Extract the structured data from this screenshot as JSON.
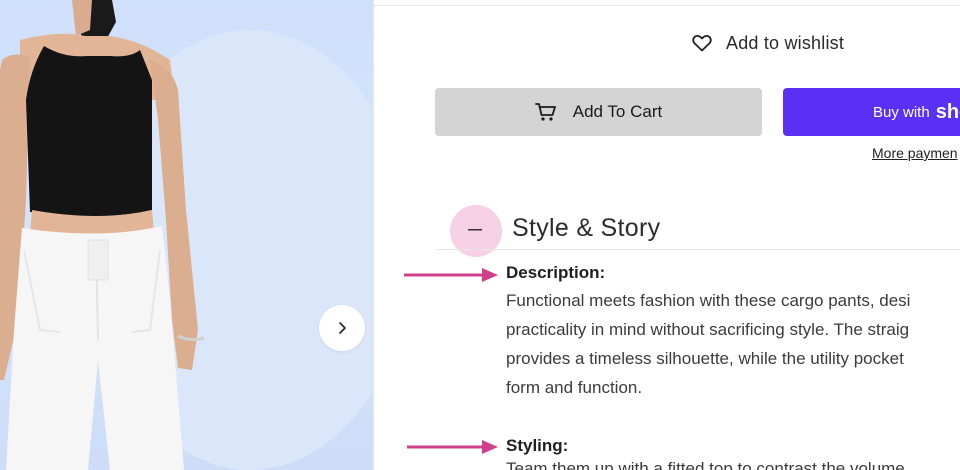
{
  "product_image": {
    "alt_icon": "model-photo"
  },
  "gallery": {
    "next_icon": "chevron-right-icon"
  },
  "wishlist": {
    "label": "Add to wishlist",
    "icon": "heart-icon"
  },
  "cart": {
    "label": "Add To Cart",
    "icon": "cart-icon"
  },
  "buy": {
    "label": "Buy with",
    "brand": "sho"
  },
  "more_payment": {
    "label": "More paymen"
  },
  "accordion": {
    "title": "Style & Story",
    "toggle_icon": "minus-icon",
    "description_heading": "Description:",
    "description_lines": [
      "Functional meets fashion with these cargo pants, desi",
      "practicality in mind without sacrificing style. The straig",
      "provides a timeless silhouette, while the utility pocket",
      "form and function."
    ],
    "styling_heading": "Styling:",
    "styling_line": "Team them up with a fitted top to contrast the volume"
  },
  "colors": {
    "accent": "#5a31f4",
    "annotation_arrow": "#d0408a",
    "highlight": "#ec96c3"
  }
}
